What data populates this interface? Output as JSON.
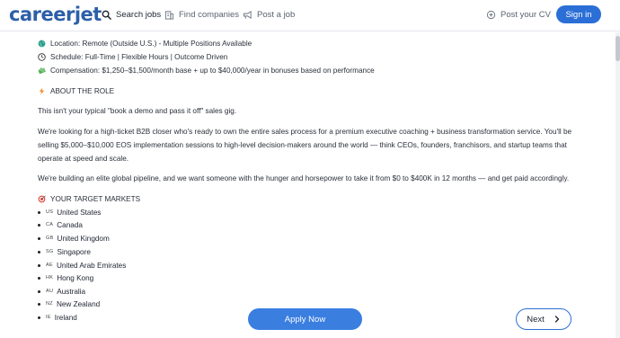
{
  "header": {
    "logo": "careerjet",
    "nav": [
      {
        "label": "Search jobs"
      },
      {
        "label": "Find companies"
      },
      {
        "label": "Post a job"
      }
    ],
    "post_cv": "Post your CV",
    "signin": "Sign in"
  },
  "details": [
    {
      "icon": "globe-icon",
      "text": "Location: Remote (Outside U.S.) - Multiple Positions Available"
    },
    {
      "icon": "clock-icon",
      "text": "Schedule: Full-Time | Flexible Hours | Outcome Driven"
    },
    {
      "icon": "money-icon",
      "text": "Compensation: $1,250–$1,500/month base + up to $40,000/year in bonuses based on performance"
    }
  ],
  "role_heading": "ABOUT THE ROLE",
  "paragraphs": {
    "p1": "This isn't your typical \"book a demo and pass it off\" sales gig.",
    "p2_line1": "We're looking for a high-ticket B2B closer who's ready to own the entire sales process for a premium executive coaching + business transformation service. You'll be",
    "p2_line2": "selling $5,000–$10,000 EOS implementation sessions to high-level decision-makers around the world — think CEOs, founders, franchisors, and startup teams that",
    "p2_line3": "operate at speed and scale.",
    "p3": "We're building an elite global pipeline, and we want someone with the hunger and horsepower to take it from $0 to $400K in 12 months — and get paid accordingly."
  },
  "markets_heading": "YOUR TARGET MARKETS",
  "markets": [
    {
      "code": "US",
      "name": "United States"
    },
    {
      "code": "CA",
      "name": "Canada"
    },
    {
      "code": "GB",
      "name": "United Kingdom"
    },
    {
      "code": "SG",
      "name": "Singapore"
    },
    {
      "code": "AE",
      "name": "United Arab Emirates"
    },
    {
      "code": "HK",
      "name": "Hong Kong"
    },
    {
      "code": "AU",
      "name": "Australia"
    },
    {
      "code": "NZ",
      "name": "New Zealand"
    },
    {
      "code": "IE",
      "name": "Ireland"
    }
  ],
  "actions": {
    "apply": "Apply Now",
    "next": "Next"
  },
  "colors": {
    "brand": "#2c5fa8",
    "primary": "#2b6fd6",
    "apply": "#3a7ee0",
    "lightning": "#f08a24",
    "target": "#e0463c"
  }
}
